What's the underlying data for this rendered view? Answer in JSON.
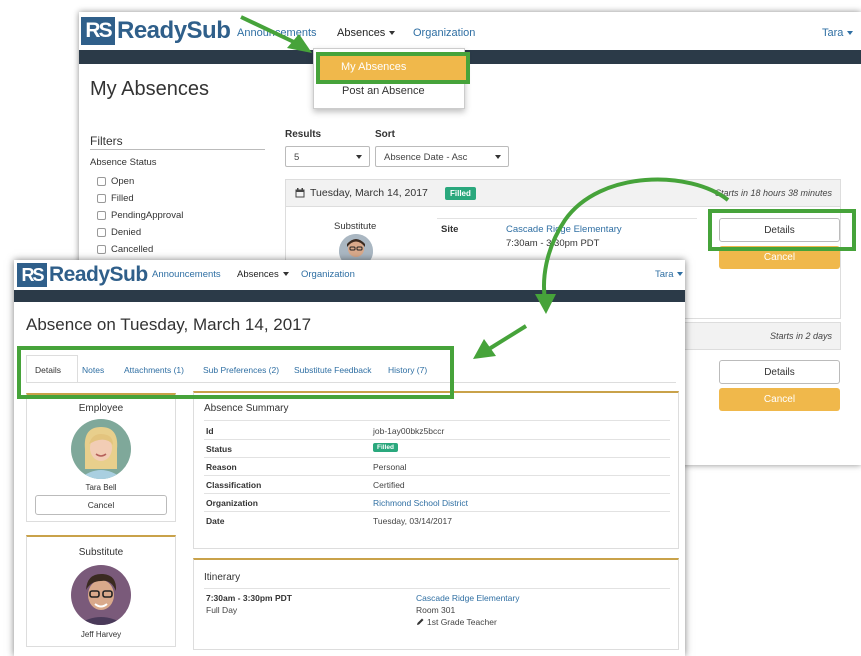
{
  "brand": {
    "logo_mark": "RS",
    "logo_text": "ReadySub"
  },
  "back": {
    "nav": {
      "announcements": "Announcements",
      "absences": "Absences",
      "organization": "Organization",
      "user": "Tara"
    },
    "dropdown": {
      "items": [
        "My Absences",
        "Post an Absence"
      ]
    },
    "page_title": "My Absences",
    "filters": {
      "title": "Filters",
      "group_label": "Absence Status",
      "options": [
        "Open",
        "Filled",
        "PendingApproval",
        "Denied",
        "Cancelled"
      ]
    },
    "results": {
      "label": "Results",
      "value": "5"
    },
    "sort": {
      "label": "Sort",
      "value": "Absence Date - Asc"
    },
    "absence1": {
      "date": "Tuesday, March 14, 2017",
      "status": "Filled",
      "starts_in": "Starts in 18 hours 38 minutes",
      "substitute_label": "Substitute",
      "site_label": "Site",
      "site_name": "Cascade Ridge Elementary",
      "time": "7:30am - 3:30pm PDT",
      "details_button": "Details",
      "cancel_button": "Cancel"
    },
    "absence2": {
      "starts_in": "Starts in 2 days",
      "details_button": "Details",
      "cancel_button": "Cancel"
    }
  },
  "front": {
    "nav": {
      "announcements": "Announcements",
      "absences": "Absences",
      "organization": "Organization",
      "user": "Tara"
    },
    "page_title": "Absence on Tuesday, March 14, 2017",
    "tabs": [
      "Details",
      "Notes",
      "Attachments (1)",
      "Sub Preferences (2)",
      "Substitute Feedback",
      "History (7)"
    ],
    "employee": {
      "title": "Employee",
      "name": "Tara Bell",
      "cancel_button": "Cancel"
    },
    "substitute": {
      "title": "Substitute",
      "name": "Jeff Harvey"
    },
    "summary": {
      "title": "Absence Summary",
      "rows": [
        {
          "label": "Id",
          "value": "job-1ay00bkz5bccr"
        },
        {
          "label": "Status",
          "value": "Filled"
        },
        {
          "label": "Reason",
          "value": "Personal"
        },
        {
          "label": "Classification",
          "value": "Certified"
        },
        {
          "label": "Organization",
          "value": "Richmond School District"
        },
        {
          "label": "Date",
          "value": "Tuesday, 03/14/2017"
        }
      ]
    },
    "itinerary": {
      "title": "Itinerary",
      "time": "7:30am - 3:30pm PDT",
      "duration": "Full Day",
      "site": "Cascade Ridge Elementary",
      "room": "Room 301",
      "position": "1st Grade Teacher"
    }
  },
  "colors": {
    "accent_blue": "#2f5f8a",
    "link": "#2f6fa3",
    "highlight_green": "#46a33a",
    "button_yellow": "#f0b84b",
    "badge_green": "#2aa87d",
    "dark_bar": "#2b3a48"
  }
}
